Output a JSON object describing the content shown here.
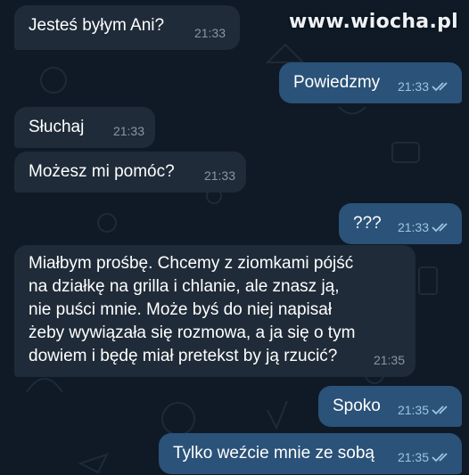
{
  "watermark": "www.wiocha.pl",
  "messages": [
    {
      "dir": "in",
      "text": "Jesteś byłym Ani?",
      "time": "21:33"
    },
    {
      "dir": "out",
      "text": "Powiedzmy",
      "time": "21:33"
    },
    {
      "dir": "in",
      "text": "Słuchaj",
      "time": "21:33"
    },
    {
      "dir": "in",
      "text": "Możesz mi pomóc?",
      "time": "21:33"
    },
    {
      "dir": "out",
      "text": "???",
      "time": "21:33"
    },
    {
      "dir": "in",
      "text": "Miałbym prośbę. Chcemy z ziomkami pójść\nna działkę na grilla i chlanie, ale znasz ją,\nnie puści mnie. Może byś do niej napisał\nżeby wywiązała się rozmowa, a ja się o tym\ndowiem i będę miał pretekst by ją rzucić?",
      "time": "21:35"
    },
    {
      "dir": "out",
      "text": "Spoko",
      "time": "21:35"
    },
    {
      "dir": "out",
      "text": "Tylko weźcie mnie ze sobą",
      "time": "21:35"
    }
  ],
  "colors": {
    "background": "#0f1a26",
    "incoming_bubble": "#1f2b38",
    "outgoing_bubble": "#2b5278",
    "read_ticks": "#9fc3e3"
  }
}
